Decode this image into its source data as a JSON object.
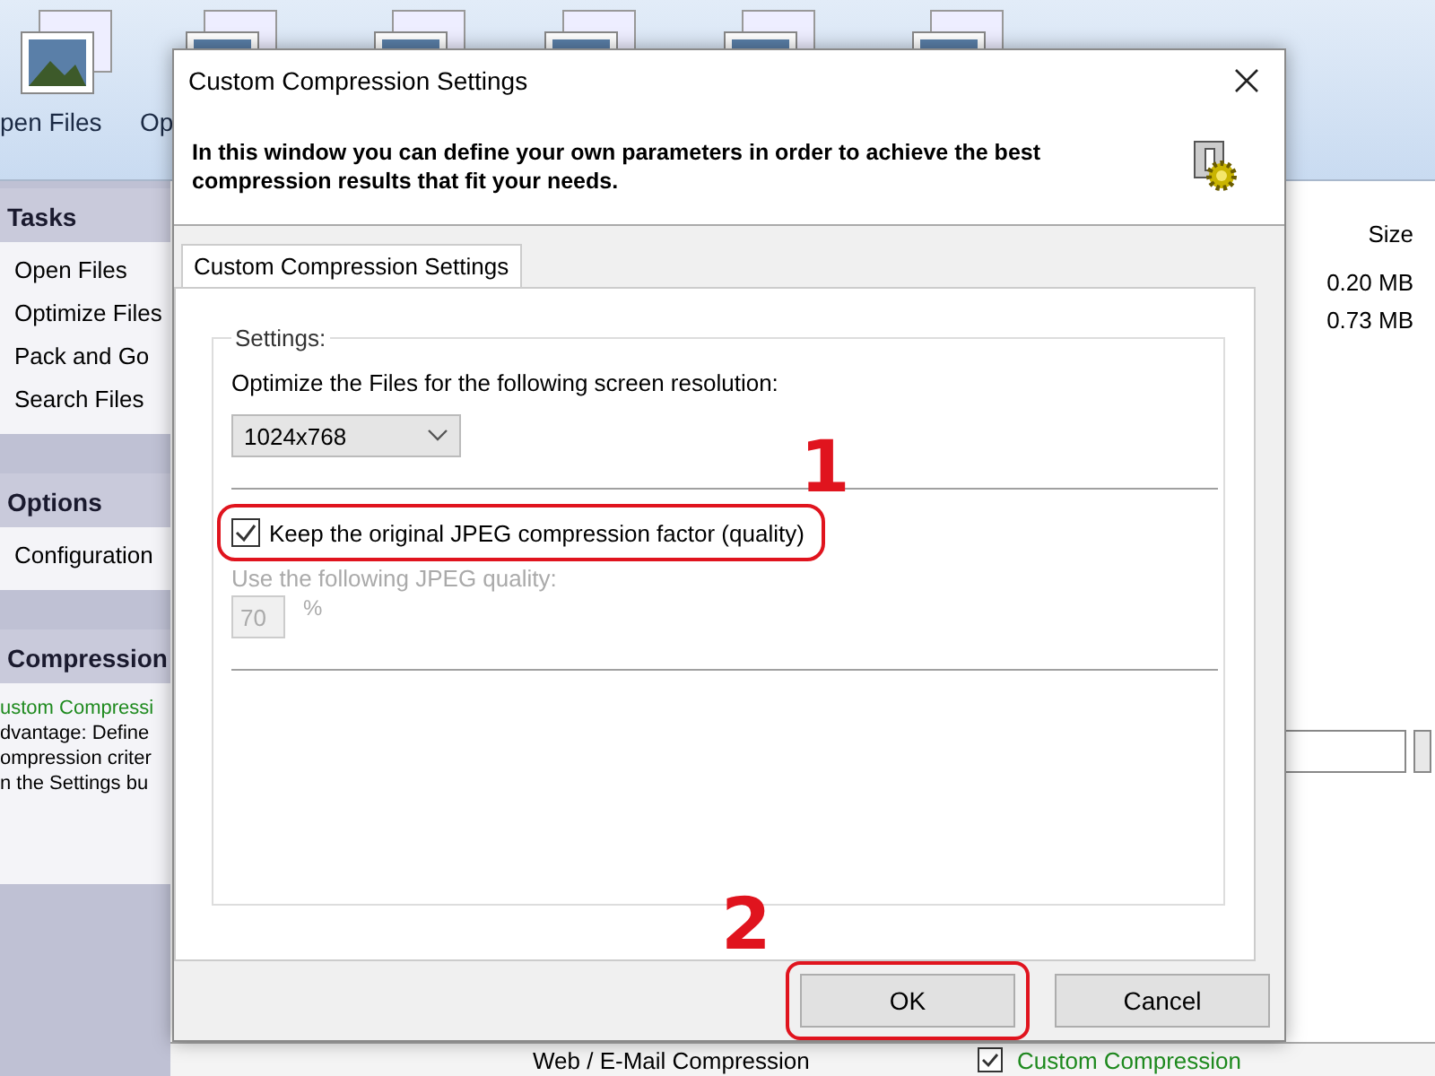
{
  "app": {
    "toolbar": [
      {
        "label": "pen Files"
      },
      {
        "label": "Op"
      }
    ],
    "sidebar": [
      {
        "kind": "links",
        "title": "Tasks",
        "items": [
          "Open Files",
          "Optimize Files",
          "Pack and Go",
          "Search Files"
        ]
      },
      {
        "kind": "links",
        "title": "Options",
        "items": [
          "Configuration"
        ]
      },
      {
        "kind": "info",
        "title": "Compression",
        "items": [
          "ustom Compressi",
          "dvantage: Define",
          "ompression criter",
          "n the Settings bu"
        ]
      }
    ],
    "file_list": {
      "columns": [
        "Size"
      ],
      "rows": [
        "0.20 MB",
        "0.73 MB"
      ]
    },
    "bottom_row": {
      "profile": "Web / E-Mail Compression",
      "custom_checked": true,
      "custom_label": "Custom Compression"
    }
  },
  "dialog": {
    "title": "Custom Compression Settings",
    "header": "In this window you can define your own parameters in order to achieve the best compression results that fit your needs.",
    "tabs": [
      {
        "label": "Custom Compression Settings",
        "selected": true
      }
    ],
    "group": {
      "title": "Settings:",
      "resolution_label": "Optimize the Files for the following screen resolution:",
      "resolution": "1024x768",
      "keep_quality": {
        "label": "Keep the original JPEG compression factor (quality)",
        "checked": true
      },
      "quality_label": "Use the following JPEG quality:",
      "quality": "70",
      "quality_unit": "%"
    },
    "buttons": [
      {
        "label": "OK"
      },
      {
        "label": "Cancel"
      }
    ]
  },
  "annotations": [
    {
      "label": "1"
    },
    {
      "label": "2"
    }
  ]
}
